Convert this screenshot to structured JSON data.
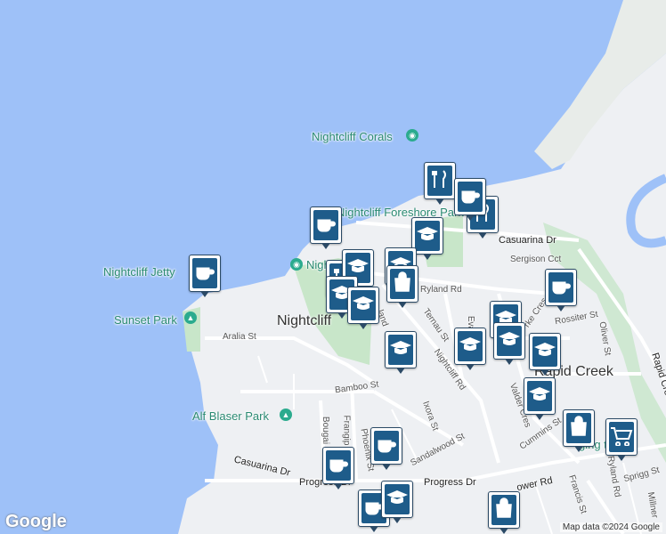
{
  "map": {
    "labels": {
      "nightcliff_corals": "Nightcliff Corals",
      "nightcliff_foreshore_park": "Nightcliff Foreshore Park",
      "nightcliff_jetty": "Nightcliff Jetty",
      "sunset_park": "Sunset Park",
      "alf_blaser_park": "Alf Blaser Park",
      "nightcliff": "Nightcliff",
      "rapid_creek": "Rapid Creek",
      "night_partial": "Nigh",
      "casuarina_dr_top": "Casuarina Dr",
      "casuarina_dr_bottom": "Casuarina Dr",
      "progress_rd_left": "Progress Dr",
      "progress_rd_mid": "Progress Dr",
      "rapid_creek_rd": "Rapid Creek Rd",
      "sergison_cct": "Sergison Cct",
      "ryland_rd": "Ryland Rd",
      "rossiter_st": "Rossiter St",
      "aralia_st": "Aralia St",
      "bamboo_st": "Bamboo St",
      "ternau_st": "Ternau St",
      "nightcliff_rd": "Nightcliff Rd",
      "ixora_st": "Ixora St",
      "sandalwood_st": "Sandalwood St",
      "valder_cres": "Valder Cres",
      "cummins_st": "Cummins St",
      "oliver_st": "Oliver St",
      "frangipani": "Frangip",
      "bougainvillea": "Bougai",
      "phoenix_st": "Phoenix St",
      "ryland_rd_bottom": "Ryland Rd",
      "spriggs_st": "Sprigg St",
      "francis_st": "Francis St",
      "trower_rd": "ower Rd",
      "millner": "Millner",
      "evans": "Eva",
      "kerr_cres": "rke Cres",
      "gardens_partial": "ging ter Ga",
      "land_partial": "land",
      "kellaway": "St"
    },
    "credit": "Map data ©2024 Google",
    "logo": "Google"
  },
  "pins": [
    {
      "type": "cafe",
      "icon": "coffee-cup-icon"
    },
    {
      "type": "restaurant",
      "icon": "fork-knife-icon"
    },
    {
      "type": "school",
      "icon": "graduation-cap-icon"
    },
    {
      "type": "shop",
      "icon": "shopping-bag-icon"
    },
    {
      "type": "supermarket",
      "icon": "shopping-cart-icon"
    }
  ],
  "colors": {
    "water": "#9ec1f8",
    "land": "#eef0f3",
    "park": "#c8e6c9",
    "pin": "#1e5c8a"
  }
}
